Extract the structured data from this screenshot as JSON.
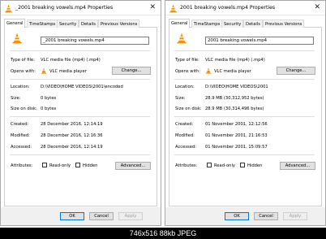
{
  "tabs": [
    "General",
    "TimeStamps",
    "Security",
    "Details",
    "Previous Versions"
  ],
  "labels": {
    "type_of_file": "Type of file:",
    "opens_with": "Opens with:",
    "location": "Location:",
    "size": "Size:",
    "size_on_disk": "Size on disk:",
    "created": "Created:",
    "modified": "Modified:",
    "accessed": "Accessed:",
    "attributes": "Attributes:",
    "read_only": "Read-only",
    "hidden": "Hidden"
  },
  "buttons": {
    "change": "Change...",
    "advanced": "Advanced...",
    "ok": "OK",
    "cancel": "Cancel",
    "apply": "Apply"
  },
  "windows": {
    "left": {
      "title": "_2001 breaking vowels.mp4 Properties",
      "filename": "_2001 breaking vowels.mp4",
      "type_of_file": "VLC media file (mp4) (.mp4)",
      "opens_with": "VLC media player",
      "location": "D:\\VIDEO\\HOME VIDEOS\\2001\\encoded",
      "size": "0 bytes",
      "size_on_disk": "0 bytes",
      "created": "28 December 2016, 12:14:19",
      "modified": "28 December 2016, 12:16:36",
      "accessed": "28 December 2016, 12:14:19"
    },
    "right": {
      "title": "2001 breaking vowels.mp4 Properties",
      "filename": "2001 breaking vowels.mp4",
      "type_of_file": "VLC media file (mp4) (.mp4)",
      "opens_with": "VLC media player",
      "location": "D:\\VIDEO\\HOME VIDEOS\\2001",
      "size": "28.9 MB (30,312,952 bytes)",
      "size_on_disk": "28.9 MB (30,314,496 bytes)",
      "created": "01 November 2001, 12:12:56",
      "modified": "01 November 2001, 21:16:53",
      "accessed": "01 November 2001, 15:09:57"
    }
  },
  "caption": "746x516 88kb JPEG",
  "colors": {
    "vlc_orange": "#f28c00",
    "primary_border": "#0078d7"
  },
  "icons": {
    "title": "vlc-cone-icon",
    "close": "close-icon"
  }
}
